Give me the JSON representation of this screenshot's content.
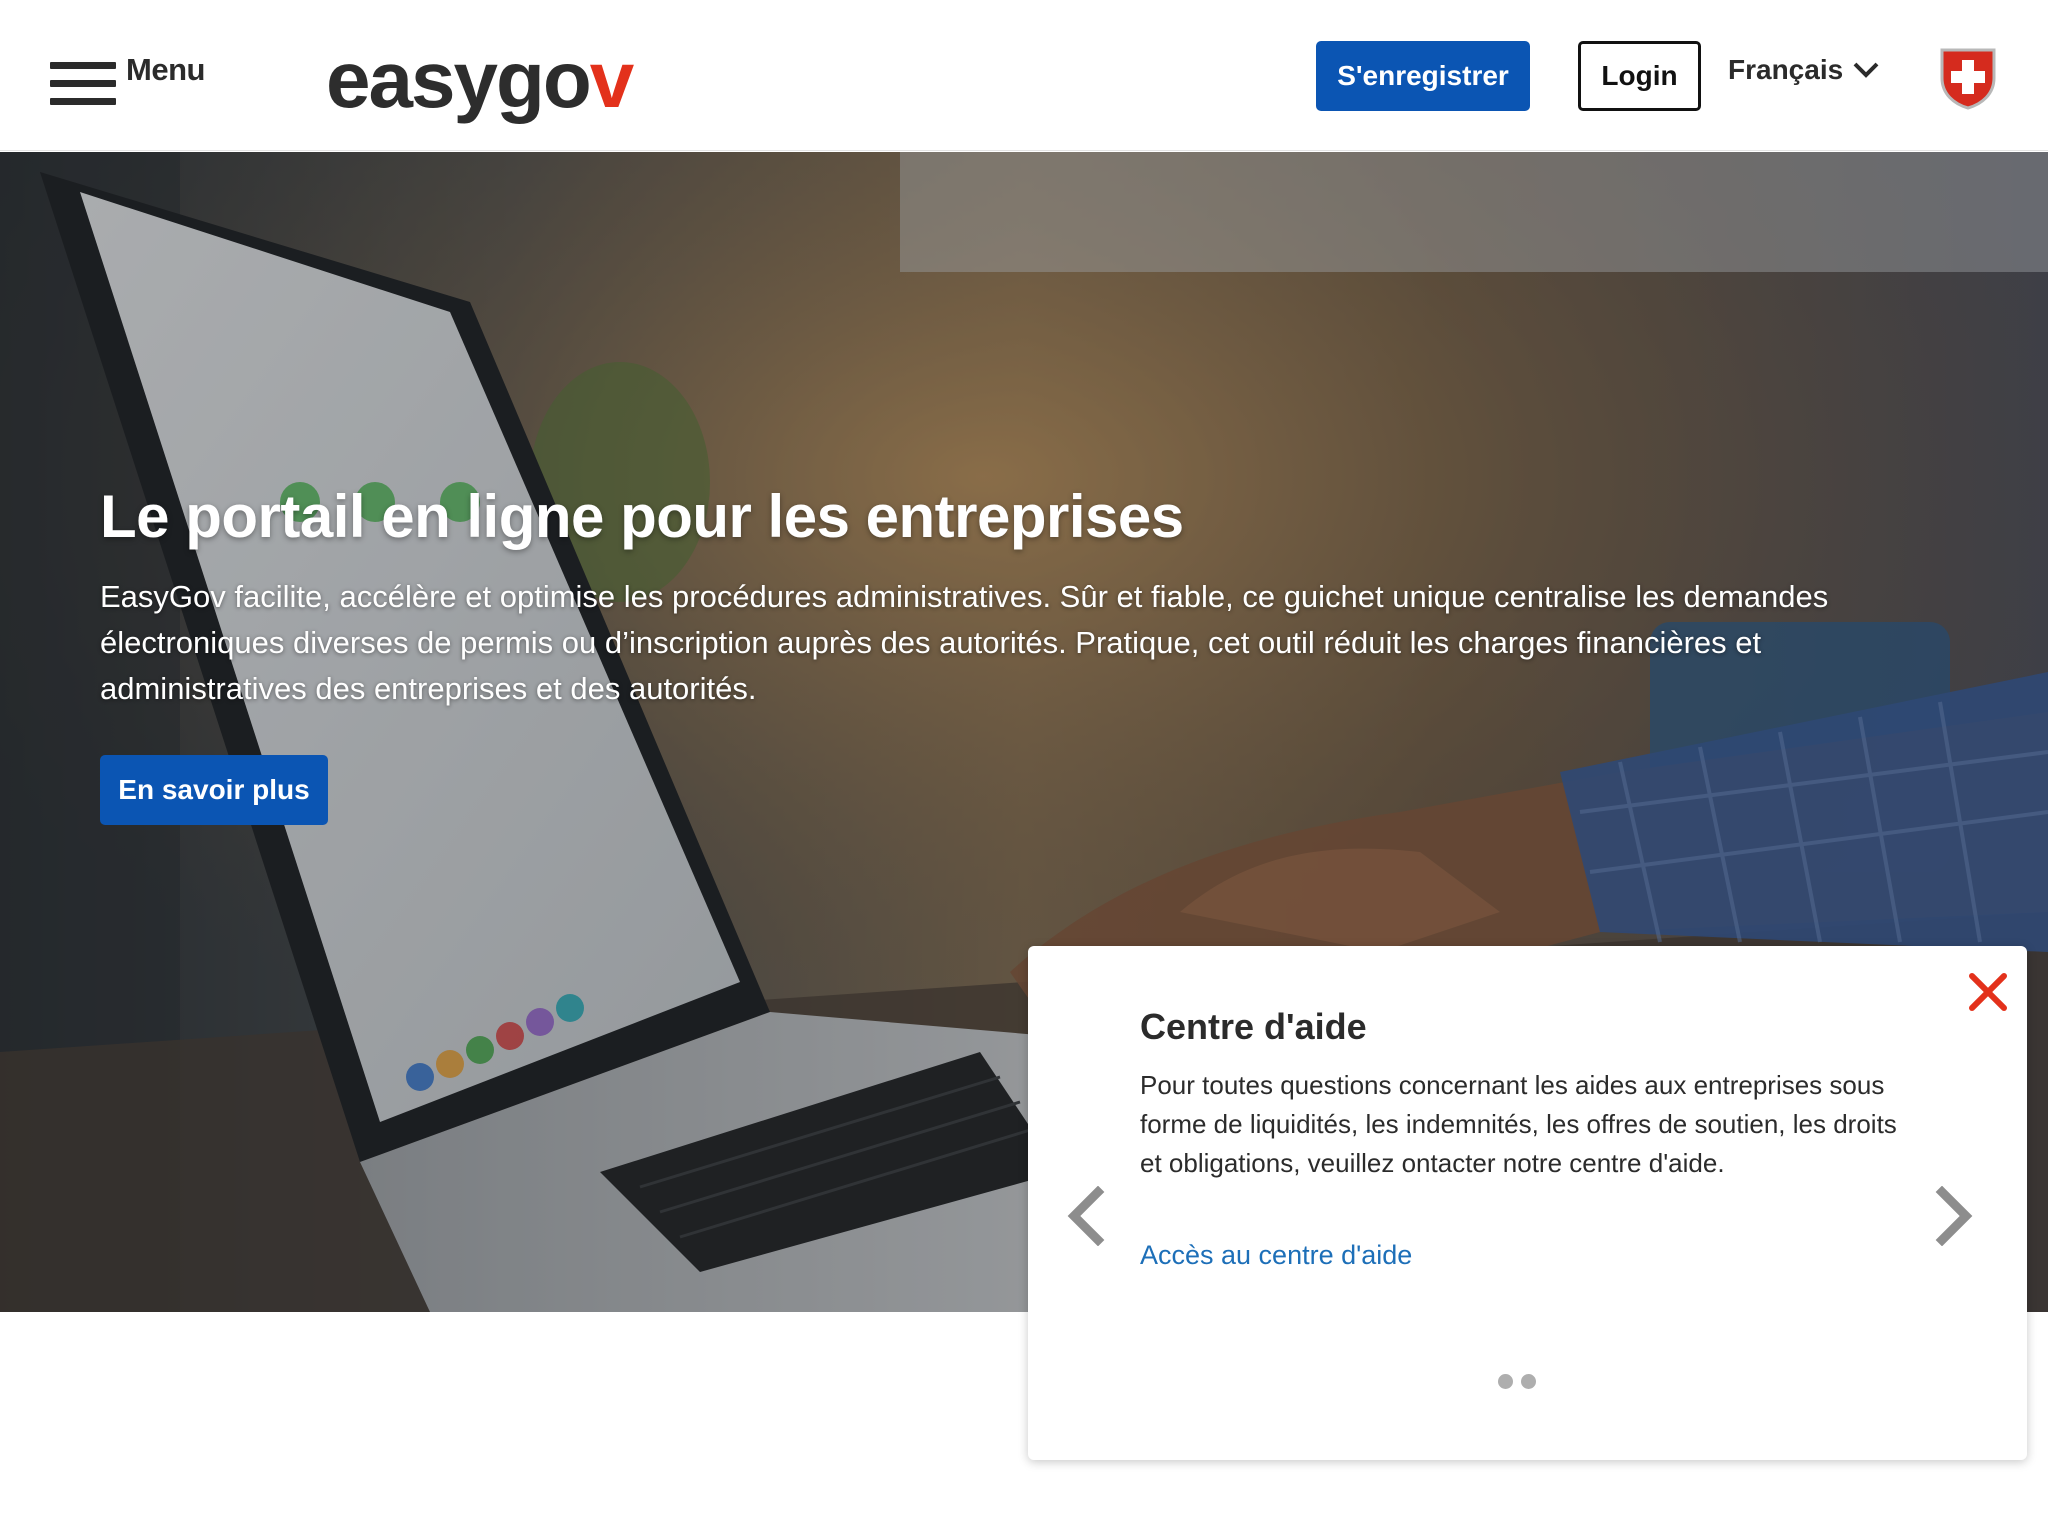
{
  "header": {
    "menu_label": "Menu",
    "logo_text": "easygo",
    "logo_accent": "v",
    "register_label": "S'enregistrer",
    "login_label": "Login",
    "language": "Français"
  },
  "hero": {
    "title": "Le portail en ligne pour les entreprises",
    "description": "EasyGov facilite, accélère et optimise les procédures administratives. Sûr et fiable, ce guichet unique centralise les demandes électroniques diverses de permis ou d’inscription auprès des autorités. Pratique, cet outil réduit les charges financières et administratives des entreprises et des autorités.",
    "cta_label": "En savoir plus"
  },
  "help_card": {
    "title": "Centre d'aide",
    "text": "Pour toutes questions concernant les aides aux entreprises sous forme de liquidités, les indemnités, les offres de soutien, les droits et obligations, veuillez ontacter notre centre d'aide.",
    "link_label": "Accès au centre d'aide",
    "slide_count": 2
  },
  "colors": {
    "brand_blue": "#0b55b3",
    "logo_red": "#e3311b",
    "link_blue": "#1d6fb8",
    "close_red": "#e3311b"
  },
  "icons": {
    "menu": "hamburger-icon",
    "language": "chevron-down-icon",
    "emblem": "swiss-shield-icon",
    "close": "close-icon",
    "prev": "chevron-left-icon",
    "next": "chevron-right-icon"
  }
}
